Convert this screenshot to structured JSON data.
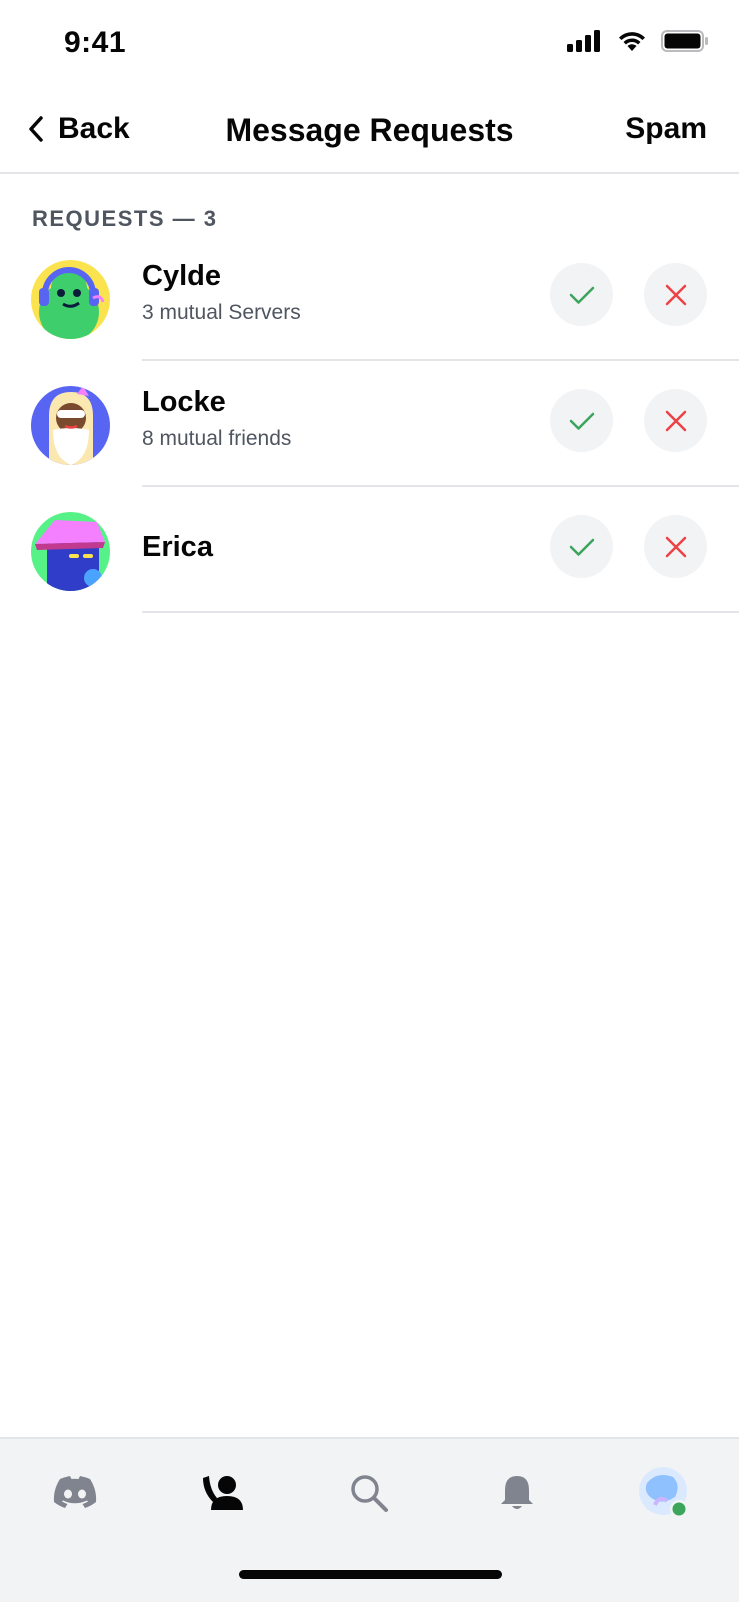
{
  "status_bar": {
    "time": "9:41"
  },
  "header": {
    "back_label": "Back",
    "title": "Message Requests",
    "spam_label": "Spam"
  },
  "section": {
    "label": "REQUESTS — 3"
  },
  "requests": [
    {
      "name": "Cylde",
      "subtitle": "3 mutual Servers"
    },
    {
      "name": "Locke",
      "subtitle": "8 mutual friends"
    },
    {
      "name": "Erica",
      "subtitle": ""
    }
  ],
  "colors": {
    "accept": "#3ba55c",
    "decline": "#ed4245",
    "button_bg": "#f2f3f5",
    "online": "#3ba55c",
    "active_tab": "#060607",
    "inactive_tab": "#80848e"
  },
  "tabs": [
    {
      "icon": "discord-home-icon",
      "active": false
    },
    {
      "icon": "friends-icon",
      "active": true
    },
    {
      "icon": "search-icon",
      "active": false
    },
    {
      "icon": "bell-icon",
      "active": false
    },
    {
      "icon": "profile-avatar",
      "active": false,
      "status": "online"
    }
  ]
}
